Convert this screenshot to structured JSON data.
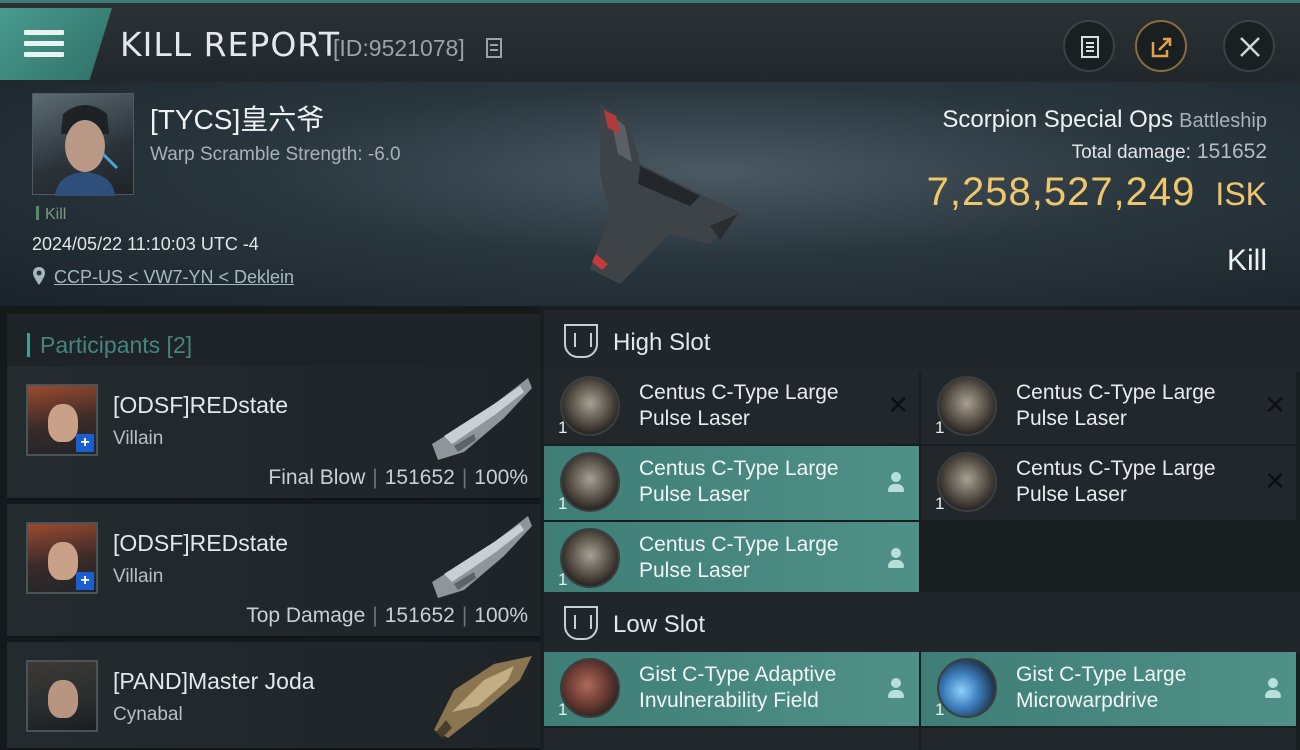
{
  "titlebar": {
    "title": "KILL REPORT",
    "report_id": "[ID:9521078]",
    "icons": [
      "menu-icon",
      "copy-icon",
      "clipboard-icon",
      "share-icon",
      "close-icon"
    ]
  },
  "victim": {
    "name": "[TYCS]皇六爷",
    "warp_scramble": "Warp Scramble Strength: -6.0",
    "tag": "Kill",
    "datetime": "2024/05/22 11:10:03 UTC -4",
    "location": "CCP-US < VW7-YN < Deklein"
  },
  "ship": {
    "name": "Scorpion Special Ops",
    "class": "Battleship",
    "total_damage_label": "Total damage:",
    "total_damage": "151652",
    "isk_value": "7,258,527,249",
    "isk_unit": "ISK",
    "result": "Kill"
  },
  "participants": {
    "header": "Participants [2]",
    "items": [
      {
        "name": "[ODSF]REDstate",
        "ship": "Villain",
        "role": "Final Blow",
        "damage": "151652",
        "percent": "100%"
      },
      {
        "name": "[ODSF]REDstate",
        "ship": "Villain",
        "role": "Top Damage",
        "damage": "151652",
        "percent": "100%"
      },
      {
        "name": "[PAND]Master Joda",
        "ship": "Cynabal"
      }
    ]
  },
  "fittings": {
    "high_slot_label": "High Slot",
    "low_slot_label": "Low Slot",
    "high": [
      {
        "name": "Centus C-Type Large Pulse Laser",
        "qty": "1",
        "state": "destroyed"
      },
      {
        "name": "Centus C-Type Large Pulse Laser",
        "qty": "1",
        "state": "destroyed"
      },
      {
        "name": "Centus C-Type Large Pulse Laser",
        "qty": "1",
        "state": "dropped"
      },
      {
        "name": "Centus C-Type Large Pulse Laser",
        "qty": "1",
        "state": "destroyed"
      },
      {
        "name": "Centus C-Type Large Pulse Laser",
        "qty": "1",
        "state": "dropped"
      }
    ],
    "low": [
      {
        "name": "Gist C-Type Adaptive Invulnerability Field",
        "qty": "1",
        "state": "dropped"
      },
      {
        "name": "Gist C-Type Large Microwarpdrive",
        "qty": "1",
        "state": "dropped"
      }
    ]
  },
  "colors": {
    "accent": "#4a9b8f",
    "isk": "#f0c66a",
    "dropped_bg": "#4f9087",
    "destroyed_bg": "#21272b"
  }
}
